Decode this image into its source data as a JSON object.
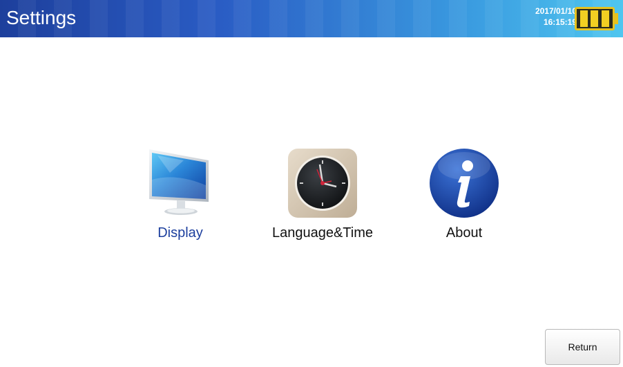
{
  "header": {
    "title": "Settings",
    "date": "2017/01/10",
    "time": "16:15:19",
    "battery_icon": "battery-full-icon",
    "battery_level": 1.0,
    "colors": {
      "bar_start": "#1d3f9c",
      "bar_end": "#4fc6ef",
      "battery": "#f2cf22"
    }
  },
  "menu": {
    "items": [
      {
        "label": "Display",
        "icon": "monitor-icon",
        "selected": true
      },
      {
        "label": "Language&Time",
        "icon": "clock-icon",
        "selected": false
      },
      {
        "label": "About",
        "icon": "info-icon",
        "selected": false
      }
    ],
    "selected_color": "#1c3f9e"
  },
  "footer": {
    "return_label": "Return"
  }
}
